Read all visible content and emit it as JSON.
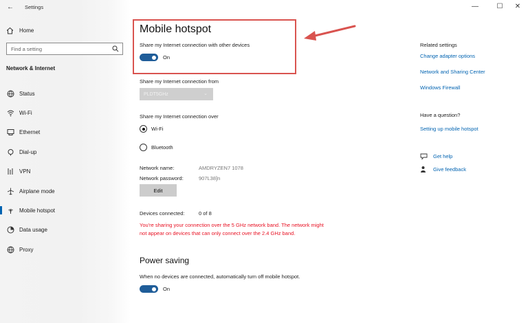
{
  "window": {
    "title": "Settings",
    "minimize": "—",
    "maximize": "☐",
    "close": "✕"
  },
  "sidebar": {
    "home_label": "Home",
    "search_placeholder": "Find a setting",
    "section_title": "Network & Internet",
    "items": [
      {
        "label": "Status",
        "icon": "globe-status-icon"
      },
      {
        "label": "Wi-Fi",
        "icon": "wifi-icon"
      },
      {
        "label": "Ethernet",
        "icon": "ethernet-icon"
      },
      {
        "label": "Dial-up",
        "icon": "dialup-icon"
      },
      {
        "label": "VPN",
        "icon": "vpn-icon"
      },
      {
        "label": "Airplane mode",
        "icon": "airplane-icon"
      },
      {
        "label": "Mobile hotspot",
        "icon": "hotspot-icon",
        "selected": true
      },
      {
        "label": "Data usage",
        "icon": "data-usage-icon"
      },
      {
        "label": "Proxy",
        "icon": "globe-icon"
      }
    ]
  },
  "main": {
    "title": "Mobile hotspot",
    "share_label": "Share my Internet connection with other devices",
    "share_toggle": "On",
    "share_from_label": "Share my Internet connection from",
    "share_from_value": "PLDT5GHz",
    "share_over_label": "Share my Internet connection over",
    "options": [
      {
        "label": "Wi-Fi",
        "selected": true
      },
      {
        "label": "Bluetooth",
        "selected": false
      }
    ],
    "network_name_label": "Network name:",
    "network_name_value": "AMDRYZEN7 1078",
    "network_password_label": "Network password:",
    "network_password_value": "907L38]n",
    "edit_label": "Edit",
    "devices_label": "Devices connected:",
    "devices_value": "0 of 8",
    "warning": "You're sharing your connection over the 5 GHz network band. The network might not appear on devices that can only connect over the 2.4 GHz band.",
    "power_saving_title": "Power saving",
    "power_saving_desc": "When no devices are connected, automatically turn off mobile hotspot.",
    "power_toggle": "On"
  },
  "related": {
    "title": "Related settings",
    "links": [
      "Change adapter options",
      "Network and Sharing Center",
      "Windows Firewall"
    ],
    "question_title": "Have a question?",
    "question_link": "Setting up mobile hotspot",
    "get_help": "Get help",
    "give_feedback": "Give feedback"
  },
  "colors": {
    "accent": "#0063b1",
    "toggle_on": "#1f5d99",
    "warning": "#e81123",
    "annotation": "#d9534f"
  }
}
